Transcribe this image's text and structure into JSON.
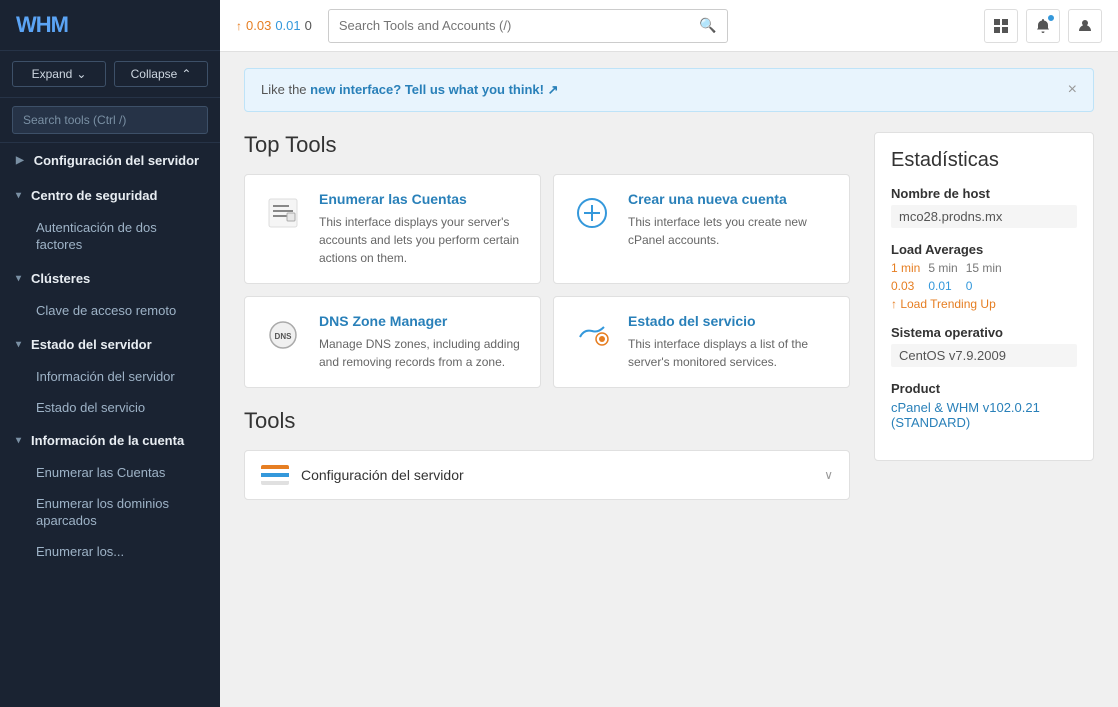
{
  "sidebar": {
    "logo": "WHM",
    "buttons": {
      "expand": "Expand",
      "collapse": "Collapse"
    },
    "search_placeholder": "Search tools (Ctrl /)",
    "nav": [
      {
        "id": "configuracion",
        "label": "Configuración del servidor",
        "expanded": false,
        "children": []
      },
      {
        "id": "seguridad",
        "label": "Centro de seguridad",
        "expanded": true,
        "children": [
          "Autenticación de dos factores"
        ]
      },
      {
        "id": "clusteres",
        "label": "Clústeres",
        "expanded": true,
        "children": [
          "Clave de acceso remoto"
        ]
      },
      {
        "id": "estado",
        "label": "Estado del servidor",
        "expanded": true,
        "children": [
          "Información del servidor",
          "Estado del servicio"
        ]
      },
      {
        "id": "cuenta",
        "label": "Información de la cuenta",
        "expanded": true,
        "children": [
          "Enumerar las Cuentas",
          "Enumerar los dominios aparcados",
          "Enumerar los..."
        ]
      }
    ]
  },
  "topbar": {
    "load_arrow": "↑",
    "load_1": "0.03",
    "load_5": "0.01",
    "load_15": "0",
    "search_placeholder": "Search Tools and Accounts (/)",
    "search_value": ""
  },
  "banner": {
    "text": "Like the",
    "link_text": "new interface?",
    "cta_text": "Tell us what you think! ↗",
    "close": "×"
  },
  "top_tools": {
    "title": "Top Tools",
    "tools": [
      {
        "id": "enumerar",
        "title": "Enumerar las Cuentas",
        "description": "This interface displays your server's accounts and lets you perform certain actions on them."
      },
      {
        "id": "crear",
        "title": "Crear una nueva cuenta",
        "description": "This interface lets you create new cPanel accounts."
      },
      {
        "id": "dns",
        "title": "DNS Zone Manager",
        "description": "Manage DNS zones, including adding and removing records from a zone."
      },
      {
        "id": "estado",
        "title": "Estado del servicio",
        "description": "This interface displays a list of the server's monitored services."
      }
    ]
  },
  "stats": {
    "title": "Estadísticas",
    "hostname_label": "Nombre de host",
    "hostname_value": "mco28.prodns.mx",
    "load_averages_label": "Load Averages",
    "load_min_labels": [
      "1 min",
      "5 min",
      "15 min"
    ],
    "load_values": [
      "0.03",
      "0.01",
      "0"
    ],
    "load_trend": "↑ Load Trending Up",
    "os_label": "Sistema operativo",
    "os_value": "CentOS v7.9.2009",
    "product_label": "Product",
    "product_value": "cPanel & WHM v102.0.21 (STANDARD)"
  },
  "tools_section": {
    "title": "Tools",
    "accordion": {
      "title": "Configuración del servidor",
      "chevron": "∨"
    }
  }
}
